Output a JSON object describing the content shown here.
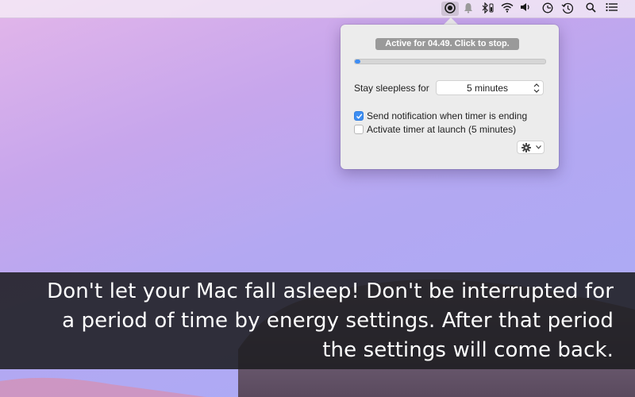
{
  "menubar": {
    "icons": [
      {
        "name": "caffeine-app-icon"
      },
      {
        "name": "notification-bell-icon"
      },
      {
        "name": "bluetooth-icon"
      },
      {
        "name": "wifi-icon"
      },
      {
        "name": "volume-icon"
      },
      {
        "name": "time-machine-icon"
      },
      {
        "name": "clock-history-icon"
      },
      {
        "name": "spotlight-search-icon"
      },
      {
        "name": "notification-center-list-icon"
      }
    ]
  },
  "popover": {
    "status_label": "Active for 04.49. Click to stop.",
    "progress": 0.03,
    "progress_color": "#3e8df3",
    "stay_label": "Stay sleepless for",
    "duration_value": "5 minutes",
    "checkboxes": [
      {
        "label": "Send notification when timer is ending",
        "checked": true
      },
      {
        "label": "Activate timer at launch (5 minutes)",
        "checked": false
      }
    ]
  },
  "caption": {
    "text": "Don't let your Mac fall asleep! Don't be interrupted for a period of time by energy settings. After that period the settings will come back."
  },
  "colors": {
    "accent": "#3d8ef2",
    "caption_band": "#1c1c20"
  }
}
